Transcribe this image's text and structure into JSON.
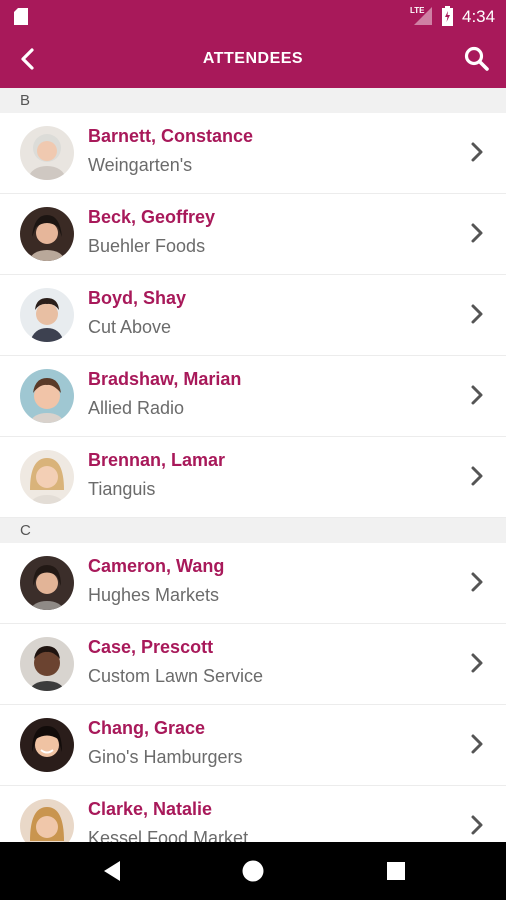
{
  "status_bar": {
    "time": "4:34",
    "network": "LTE"
  },
  "app_bar": {
    "title": "ATTENDEES"
  },
  "colors": {
    "accent": "#a8195a",
    "company_text": "#6b6b6b",
    "section_bg": "#f1f1f1"
  },
  "sections": [
    {
      "letter": "B",
      "attendees": [
        {
          "name": "Barnett, Constance",
          "company": "Weingarten's"
        },
        {
          "name": "Beck, Geoffrey",
          "company": "Buehler Foods"
        },
        {
          "name": "Boyd, Shay",
          "company": "Cut Above"
        },
        {
          "name": "Bradshaw, Marian",
          "company": "Allied Radio"
        },
        {
          "name": "Brennan, Lamar",
          "company": "Tianguis"
        }
      ]
    },
    {
      "letter": "C",
      "attendees": [
        {
          "name": "Cameron, Wang",
          "company": "Hughes Markets"
        },
        {
          "name": "Case, Prescott",
          "company": "Custom Lawn Service"
        },
        {
          "name": "Chang, Grace",
          "company": "Gino's Hamburgers"
        },
        {
          "name": "Clarke, Natalie",
          "company": "Kessel Food Market"
        }
      ]
    }
  ],
  "icons": {
    "back": "arrow-left-icon",
    "search": "search-icon",
    "row_action": "chevron-right-icon",
    "nav_back": "triangle-back-icon",
    "nav_home": "circle-home-icon",
    "nav_recents": "square-recents-icon"
  }
}
